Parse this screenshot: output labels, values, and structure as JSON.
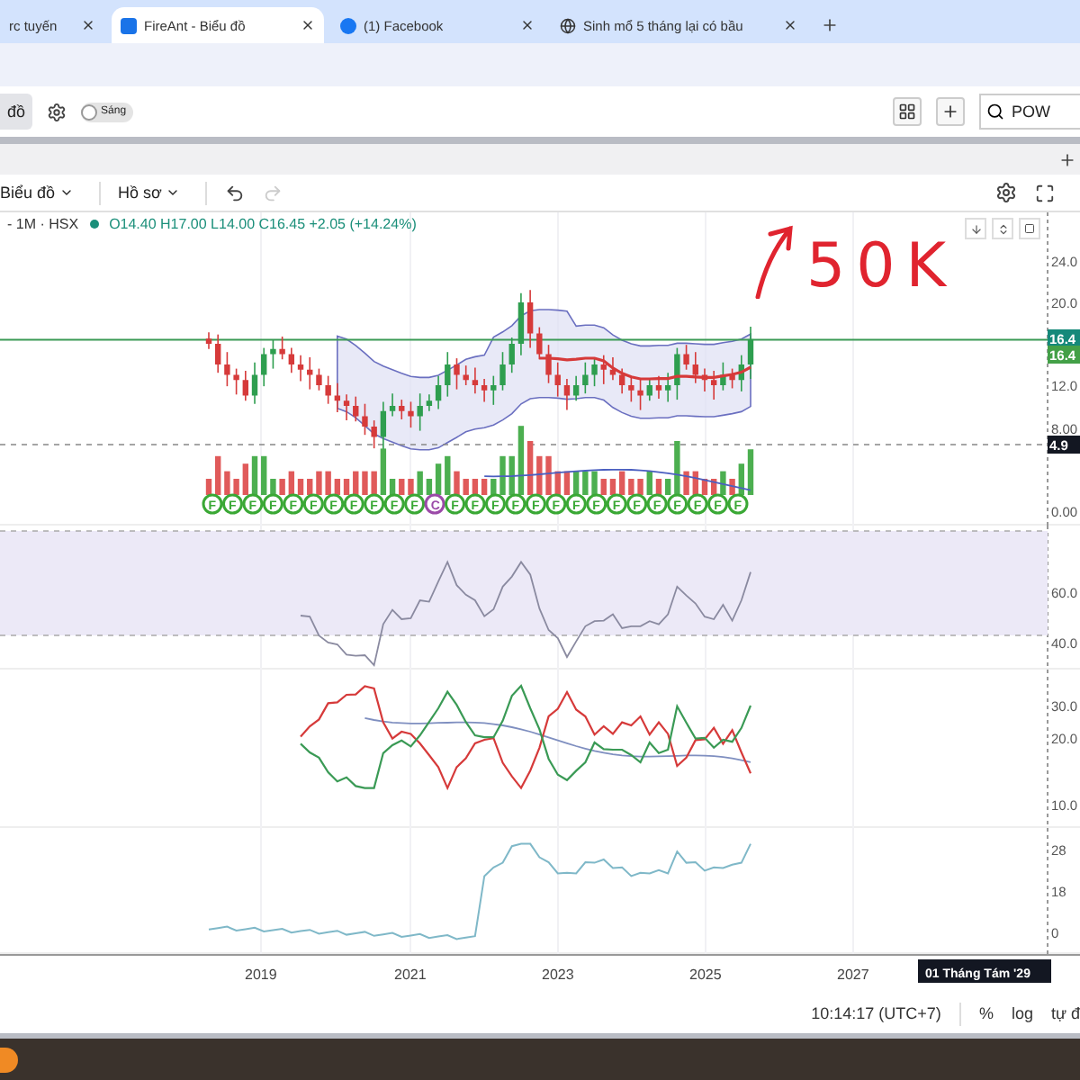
{
  "browser_tabs": [
    {
      "title": "rc tuyến",
      "selected": false
    },
    {
      "title": "FireAnt - Biểu đồ",
      "selected": true
    },
    {
      "title": "(1) Facebook",
      "selected": false
    },
    {
      "title": "Sinh mổ 5 tháng lại có bầu",
      "selected": false
    }
  ],
  "app_toolbar": {
    "chart_button": "đồ",
    "theme_toggle": {
      "label": "Sáng",
      "on": false
    },
    "symbol_search": {
      "value": "POW"
    }
  },
  "chart_toolbar": {
    "menus": [
      "Biểu đồ",
      "Hồ sơ"
    ],
    "redo_disabled": true
  },
  "legend": {
    "symbol": "- 1M · HSX",
    "ohlc": "O14.40 H17.00 L14.00 C16.45 +2.05 (+14.24%)"
  },
  "annotation": "50K",
  "panes": [
    {
      "kind": "price",
      "ticks": [
        {
          "label": "24.0",
          "kind": "plain"
        },
        {
          "label": "20.0",
          "kind": "plain"
        },
        {
          "label": "16.4",
          "kind": "tag",
          "color": "#15897a"
        },
        {
          "label": "16.4",
          "kind": "tag",
          "color": "#43a047"
        },
        {
          "label": "12.0",
          "kind": "plain"
        },
        {
          "label": "8.00",
          "kind": "plain"
        },
        {
          "label": "4.9",
          "kind": "tag",
          "color": "#131722"
        },
        {
          "label": "0.00",
          "kind": "plain"
        }
      ]
    },
    {
      "kind": "rsi",
      "ticks": [
        {
          "label": "60.0",
          "kind": "plain"
        },
        {
          "label": "40.0",
          "kind": "plain"
        }
      ]
    },
    {
      "kind": "dmi",
      "ticks": [
        {
          "label": "30.0",
          "kind": "plain"
        },
        {
          "label": "20.0",
          "kind": "plain"
        },
        {
          "label": "10.0",
          "kind": "plain"
        }
      ]
    },
    {
      "kind": "flow",
      "ticks": [
        {
          "label": "28",
          "kind": "plain"
        },
        {
          "label": "18",
          "kind": "plain"
        },
        {
          "label": "0",
          "kind": "plain"
        }
      ]
    }
  ],
  "event_markers": [
    {
      "letter": "F",
      "color": "#3aa835"
    },
    {
      "letter": "F",
      "color": "#3aa835"
    },
    {
      "letter": "F",
      "color": "#3aa835"
    },
    {
      "letter": "F",
      "color": "#3aa835"
    },
    {
      "letter": "F",
      "color": "#3aa835"
    },
    {
      "letter": "F",
      "color": "#3aa835"
    },
    {
      "letter": "F",
      "color": "#3aa835"
    },
    {
      "letter": "F",
      "color": "#3aa835"
    },
    {
      "letter": "F",
      "color": "#3aa835"
    },
    {
      "letter": "F",
      "color": "#3aa835"
    },
    {
      "letter": "F",
      "color": "#3aa835"
    },
    {
      "letter": "C",
      "color": "#9b4aa8"
    },
    {
      "letter": "F",
      "color": "#3aa835"
    },
    {
      "letter": "F",
      "color": "#3aa835"
    },
    {
      "letter": "F",
      "color": "#3aa835"
    },
    {
      "letter": "F",
      "color": "#3aa835"
    },
    {
      "letter": "F",
      "color": "#3aa835"
    },
    {
      "letter": "F",
      "color": "#3aa835"
    },
    {
      "letter": "F",
      "color": "#3aa835"
    },
    {
      "letter": "F",
      "color": "#3aa835"
    },
    {
      "letter": "F",
      "color": "#3aa835"
    },
    {
      "letter": "F",
      "color": "#3aa835"
    },
    {
      "letter": "F",
      "color": "#3aa835"
    },
    {
      "letter": "F",
      "color": "#3aa835"
    },
    {
      "letter": "F",
      "color": "#3aa835"
    },
    {
      "letter": "F",
      "color": "#3aa835"
    },
    {
      "letter": "F",
      "color": "#3aa835"
    }
  ],
  "x_axis": {
    "labels": [
      "2019",
      "2021",
      "2023",
      "2025",
      "2027"
    ],
    "cursor_label": "01 Tháng Tám '29"
  },
  "status_bar": {
    "time": "10:14:17 (UTC+7)",
    "options": [
      "%",
      "log",
      "tự đ"
    ]
  }
}
